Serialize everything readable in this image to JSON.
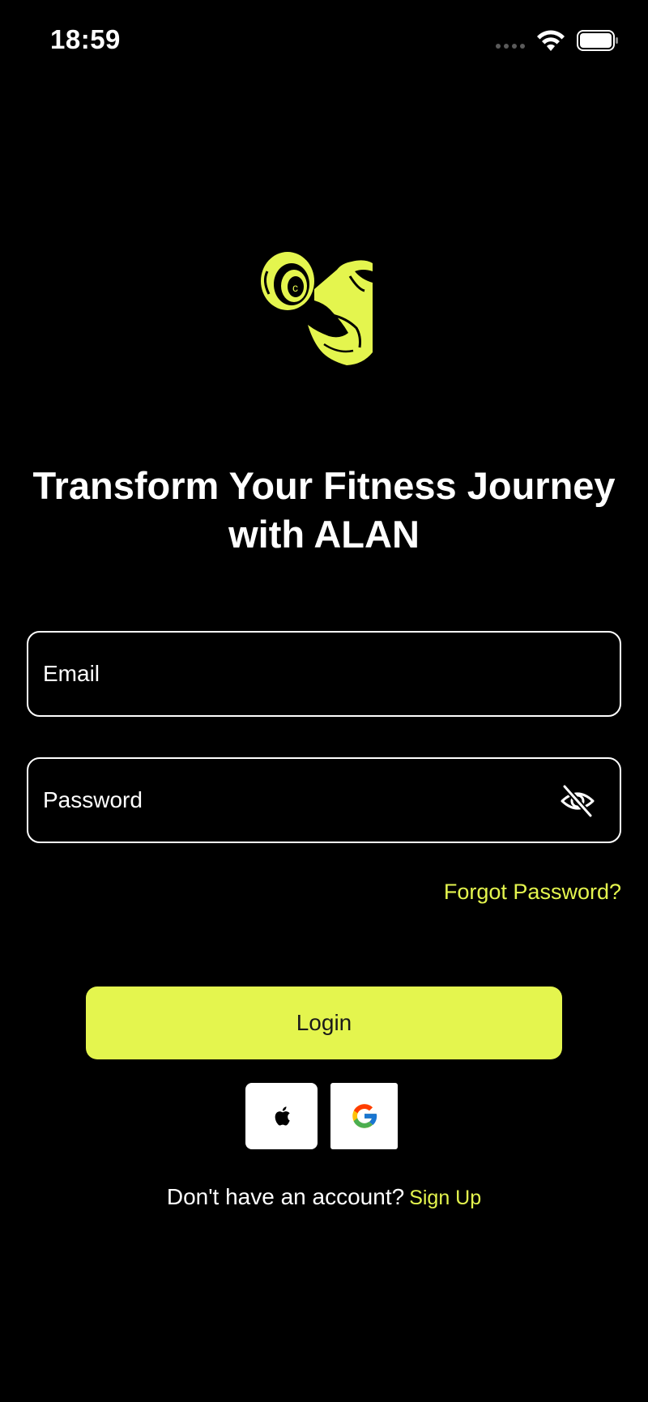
{
  "status_bar": {
    "time": "18:59",
    "icons": [
      "cellular-signal-icon",
      "wifi-icon",
      "battery-icon"
    ]
  },
  "brand": {
    "logo_icon": "dumbbell-flexed-arm-logo",
    "accent_color": "#e4f54e",
    "background_color": "#000000"
  },
  "headline": {
    "line1": "Transform Your Fitness Journey",
    "line2": "with ALAN"
  },
  "form": {
    "email_placeholder": "Email",
    "email_value": "",
    "password_placeholder": "Password",
    "password_value": "",
    "password_toggle_icon": "eye-slash-icon",
    "forgot_password": "Forgot Password?",
    "login_label": "Login"
  },
  "social": {
    "apple_icon": "apple-icon",
    "google_icon": "google-icon"
  },
  "signup": {
    "prompt": "Don't have an account?",
    "link": "Sign Up"
  }
}
